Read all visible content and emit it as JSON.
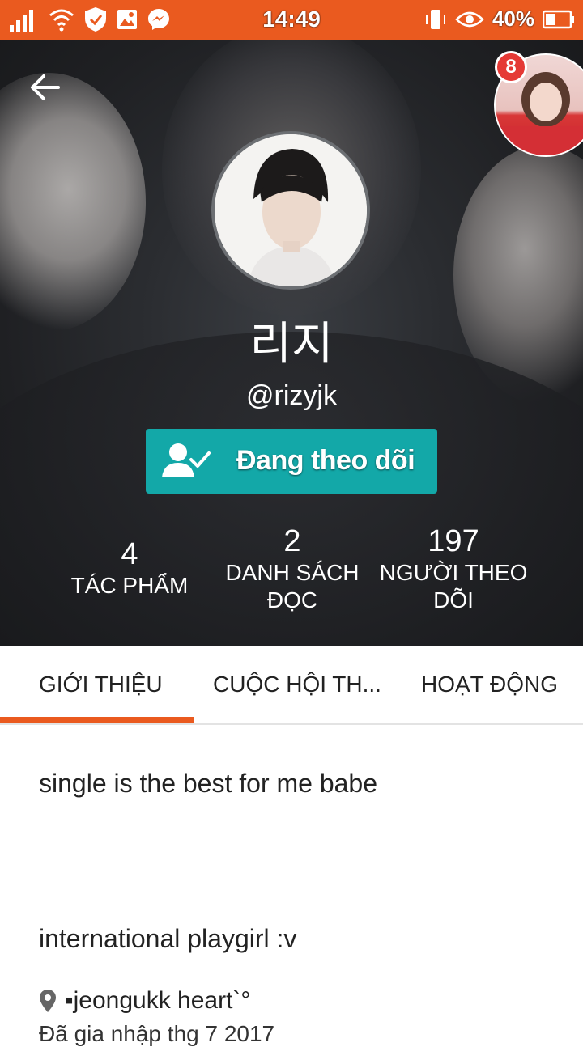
{
  "status_bar": {
    "time": "14:49",
    "battery": "40%",
    "icons": [
      "signal-icon",
      "wifi-icon",
      "shield-icon",
      "gallery-icon",
      "messenger-icon",
      "vibrate-icon",
      "eye-icon",
      "battery-icon"
    ]
  },
  "header": {
    "back_icon": "arrow-left-icon",
    "chat_bubble_badge": "8"
  },
  "profile": {
    "display_name": "리지",
    "username": "@rizyjk",
    "follow_button": "Đang theo dõi"
  },
  "stats": [
    {
      "value": "4",
      "label": "TÁC PHẨM"
    },
    {
      "value": "2",
      "label": "DANH SÁCH ĐỌC"
    },
    {
      "value": "197",
      "label": "NGƯỜI THEO DÕI"
    }
  ],
  "tabs": [
    {
      "label": "GIỚI THIỆU",
      "active": true
    },
    {
      "label": "CUỘC HỘI TH...",
      "active": false
    },
    {
      "label": "HOẠT ĐỘNG",
      "active": false
    }
  ],
  "about": {
    "bio_line1": "single is the best for me babe",
    "bio_line2": "international playgirl :v",
    "location": "▪jeongukk heart`°",
    "joined": "Đã gia nhập thg 7 2017"
  },
  "colors": {
    "accent": "#ea5a1f",
    "follow_button": "#13a8a8"
  }
}
